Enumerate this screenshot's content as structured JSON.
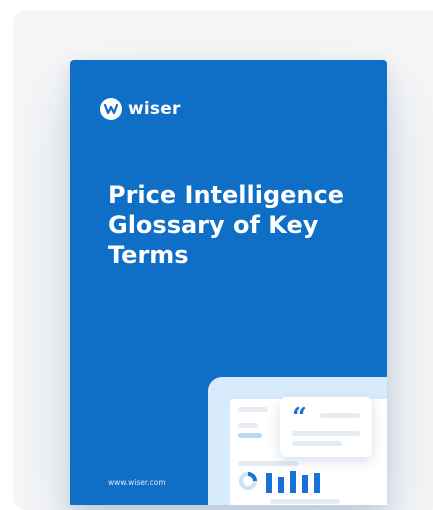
{
  "brand": {
    "name": "wiser"
  },
  "cover": {
    "title_lines": [
      "Price Intelligence",
      "Glossary of Key",
      "Terms"
    ],
    "footer_url": "www.wiser.com",
    "background_color": "#0f6fc6"
  }
}
